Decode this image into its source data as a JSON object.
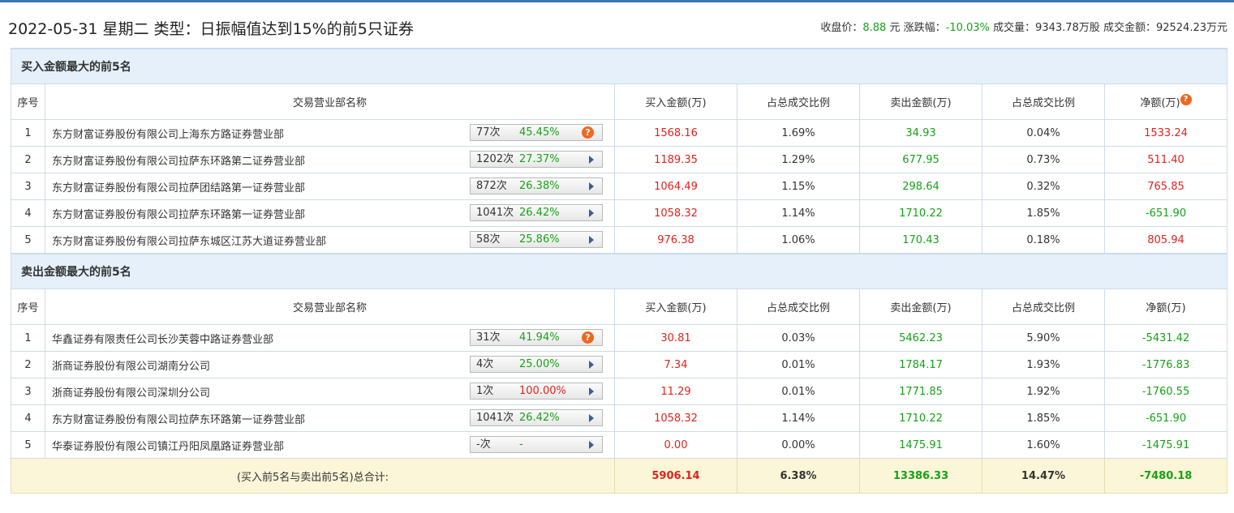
{
  "header": {
    "title": "2022-05-31 星期二 类型：日振幅值达到15%的前5只证券",
    "close_label": "收盘价：",
    "close_value": "8.88",
    "close_unit": "元",
    "change_label": "涨跌幅：",
    "change_value": "-10.03%",
    "volume_label": "成交量：",
    "volume_value": "9343.78万股",
    "turnover_label": "成交金额：",
    "turnover_value": "92524.23万元"
  },
  "columns": [
    "序号",
    "交易营业部名称",
    "买入金额(万)",
    "占总成交比例",
    "卖出金额(万)",
    "占总成交比例",
    "净额(万)"
  ],
  "buy": {
    "title": "买入金额最大的前5名",
    "rows": [
      {
        "idx": "1",
        "name": "东方财富证券股份有限公司上海东方路证券营业部",
        "times": "77次",
        "pct": "45.45%",
        "pct_color": "green",
        "icon": "question",
        "buy": "1568.16",
        "buy_ratio": "1.69%",
        "sell": "34.93",
        "sell_ratio": "0.04%",
        "net": "1533.24",
        "net_color": "red"
      },
      {
        "idx": "2",
        "name": "东方财富证券股份有限公司拉萨东环路第二证券营业部",
        "times": "1202次",
        "pct": "27.37%",
        "pct_color": "green",
        "icon": "arrow",
        "buy": "1189.35",
        "buy_ratio": "1.29%",
        "sell": "677.95",
        "sell_ratio": "0.73%",
        "net": "511.40",
        "net_color": "red"
      },
      {
        "idx": "3",
        "name": "东方财富证券股份有限公司拉萨团结路第一证券营业部",
        "times": "872次",
        "pct": "26.38%",
        "pct_color": "green",
        "icon": "arrow",
        "buy": "1064.49",
        "buy_ratio": "1.15%",
        "sell": "298.64",
        "sell_ratio": "0.32%",
        "net": "765.85",
        "net_color": "red"
      },
      {
        "idx": "4",
        "name": "东方财富证券股份有限公司拉萨东环路第一证券营业部",
        "times": "1041次",
        "pct": "26.42%",
        "pct_color": "green",
        "icon": "arrow",
        "buy": "1058.32",
        "buy_ratio": "1.14%",
        "sell": "1710.22",
        "sell_ratio": "1.85%",
        "net": "-651.90",
        "net_color": "green"
      },
      {
        "idx": "5",
        "name": "东方财富证券股份有限公司拉萨东城区江苏大道证券营业部",
        "times": "58次",
        "pct": "25.86%",
        "pct_color": "green",
        "icon": "arrow",
        "buy": "976.38",
        "buy_ratio": "1.06%",
        "sell": "170.43",
        "sell_ratio": "0.18%",
        "net": "805.94",
        "net_color": "red"
      }
    ]
  },
  "sell": {
    "title": "卖出金额最大的前5名",
    "rows": [
      {
        "idx": "1",
        "name": "华鑫证券有限责任公司长沙芙蓉中路证券营业部",
        "times": "31次",
        "pct": "41.94%",
        "pct_color": "green",
        "icon": "question",
        "buy": "30.81",
        "buy_ratio": "0.03%",
        "sell": "5462.23",
        "sell_ratio": "5.90%",
        "net": "-5431.42",
        "net_color": "green"
      },
      {
        "idx": "2",
        "name": "浙商证券股份有限公司湖南分公司",
        "times": "4次",
        "pct": "25.00%",
        "pct_color": "green",
        "icon": "arrow",
        "buy": "7.34",
        "buy_ratio": "0.01%",
        "sell": "1784.17",
        "sell_ratio": "1.93%",
        "net": "-1776.83",
        "net_color": "green"
      },
      {
        "idx": "3",
        "name": "浙商证券股份有限公司深圳分公司",
        "times": "1次",
        "pct": "100.00%",
        "pct_color": "red",
        "icon": "arrow",
        "buy": "11.29",
        "buy_ratio": "0.01%",
        "sell": "1771.85",
        "sell_ratio": "1.92%",
        "net": "-1760.55",
        "net_color": "green"
      },
      {
        "idx": "4",
        "name": "东方财富证券股份有限公司拉萨东环路第一证券营业部",
        "times": "1041次",
        "pct": "26.42%",
        "pct_color": "green",
        "icon": "arrow",
        "buy": "1058.32",
        "buy_ratio": "1.14%",
        "sell": "1710.22",
        "sell_ratio": "1.85%",
        "net": "-651.90",
        "net_color": "green"
      },
      {
        "idx": "5",
        "name": "华泰证券股份有限公司镇江丹阳凤凰路证券营业部",
        "times": "-次",
        "pct": "-",
        "pct_color": "green",
        "icon": "arrow",
        "buy": "0.00",
        "buy_ratio": "0.00%",
        "sell": "1475.91",
        "sell_ratio": "1.60%",
        "net": "-1475.91",
        "net_color": "green"
      }
    ]
  },
  "total": {
    "label": "(买入前5名与卖出前5名)总合计:",
    "buy": "5906.14",
    "buy_ratio": "6.38%",
    "sell": "13386.33",
    "sell_ratio": "14.47%",
    "net": "-7480.18"
  },
  "colors": {
    "red": "#e2221b",
    "green": "#16a216",
    "accent": "#3f74b4",
    "section_bg": "#e6f0fa",
    "total_bg": "#fcf6d8"
  }
}
